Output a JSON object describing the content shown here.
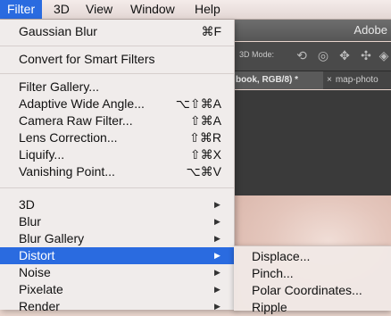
{
  "menubar": {
    "items": [
      "Filter",
      "3D",
      "View",
      "Window",
      "Help"
    ]
  },
  "filter_menu": {
    "last_filter": {
      "label": "Gaussian Blur",
      "shortcut": "⌘F"
    },
    "convert": {
      "label": "Convert for Smart Filters"
    },
    "group1": [
      {
        "label": "Filter Gallery...",
        "shortcut": ""
      },
      {
        "label": "Adaptive Wide Angle...",
        "shortcut": "⌥⇧⌘A"
      },
      {
        "label": "Camera Raw Filter...",
        "shortcut": "⇧⌘A"
      },
      {
        "label": "Lens Correction...",
        "shortcut": "⇧⌘R"
      },
      {
        "label": "Liquify...",
        "shortcut": "⇧⌘X"
      },
      {
        "label": "Vanishing Point...",
        "shortcut": "⌥⌘V"
      }
    ],
    "group2": [
      {
        "label": "3D"
      },
      {
        "label": "Blur"
      },
      {
        "label": "Blur Gallery"
      },
      {
        "label": "Distort"
      },
      {
        "label": "Noise"
      },
      {
        "label": "Pixelate"
      },
      {
        "label": "Render"
      }
    ],
    "selected": "Distort"
  },
  "distort_submenu": {
    "items": [
      "Displace...",
      "Pinch...",
      "Polar Coordinates...",
      "Ripple"
    ]
  },
  "app": {
    "title": "Adobe",
    "mode_label": "3D Mode:",
    "tabs": [
      {
        "label": "book, RGB/8) *"
      },
      {
        "label": "map-photo"
      }
    ],
    "tab_close": "×"
  },
  "colors": {
    "accent": "#2a6be0"
  }
}
